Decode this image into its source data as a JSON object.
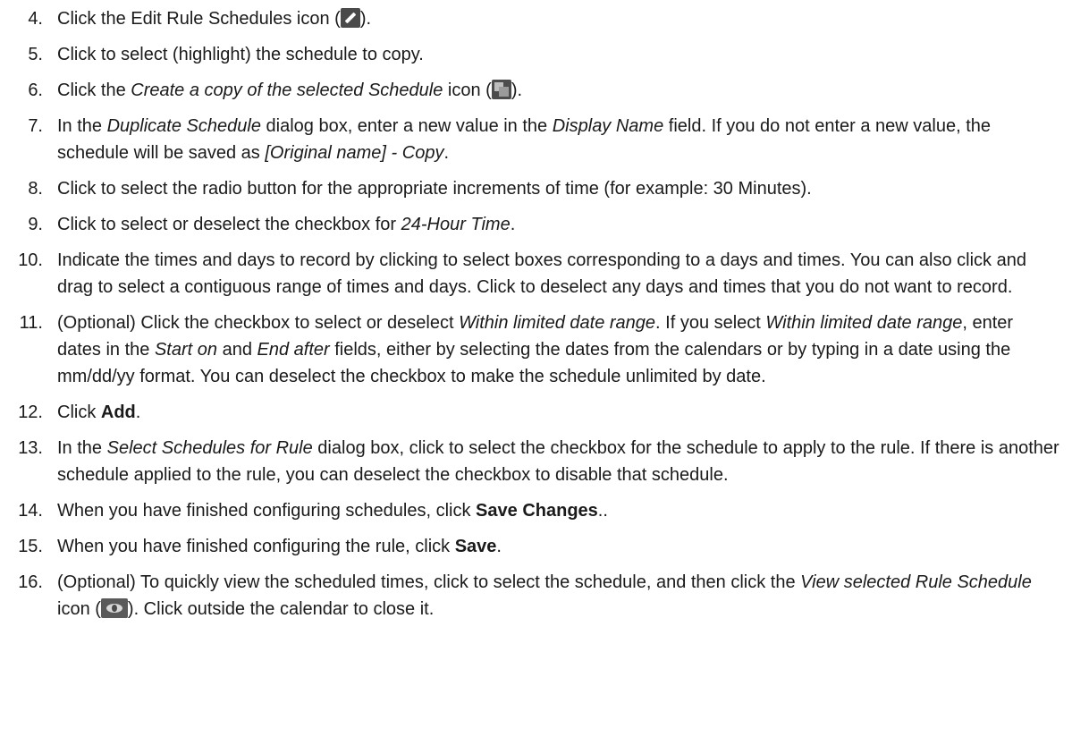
{
  "steps": [
    {
      "num": "4.",
      "parts": [
        "Click the Edit Rule Schedules icon (",
        ")."
      ]
    },
    {
      "num": "5.",
      "parts": [
        "Click to select (highlight) the schedule to copy."
      ]
    },
    {
      "num": "6.",
      "parts": [
        "Click the ",
        "Create a copy of the selected Schedule",
        " icon (",
        ")."
      ]
    },
    {
      "num": "7.",
      "parts": [
        "In the ",
        "Duplicate Schedule",
        " dialog box, enter a new value in the ",
        "Display Name",
        " field. If you do not enter a new value, the schedule will be saved as ",
        "[Original name] - Copy",
        "."
      ]
    },
    {
      "num": "8.",
      "parts": [
        "Click to select the radio button for the appropriate increments of time (for example: 30 Minutes)."
      ]
    },
    {
      "num": "9.",
      "parts": [
        "Click to select or deselect the checkbox for ",
        "24-Hour Time",
        "."
      ]
    },
    {
      "num": "10.",
      "parts": [
        "Indicate the times and days to record by clicking to select boxes corresponding to a days and times. You can also click and drag to select a contiguous range of times and days. Click to deselect any days and times that you do not want to record."
      ]
    },
    {
      "num": "11.",
      "parts": [
        "(Optional) Click the checkbox to select or deselect ",
        "Within limited date range",
        ". If you select ",
        "Within limited date range",
        ", enter dates in the ",
        "Start on",
        " and ",
        "End after",
        " fields, either by selecting the dates from the calendars or by typing in a date using the mm/dd/yy format. You can deselect the checkbox to make the schedule unlimited by date."
      ]
    },
    {
      "num": "12.",
      "parts": [
        "Click ",
        "Add",
        "."
      ]
    },
    {
      "num": "13.",
      "parts": [
        "In the ",
        "Select Schedules for Rule",
        " dialog box, click to select the checkbox for the schedule to apply to the rule. If there is another schedule applied to the rule, you can deselect the checkbox to disable that schedule."
      ]
    },
    {
      "num": "14.",
      "parts": [
        "When you have finished configuring schedules, click ",
        "Save Changes",
        ".."
      ]
    },
    {
      "num": "15.",
      "parts": [
        "When you have finished configuring the rule, click ",
        "Save",
        "."
      ]
    },
    {
      "num": "16.",
      "parts": [
        "(Optional) To quickly view the scheduled times, click to select the schedule, and then click the ",
        "View selected Rule Schedule",
        " icon (",
        "). Click outside the calendar to close it."
      ]
    }
  ],
  "icons": {
    "edit": "pencil-icon",
    "copy": "copy-icon",
    "view": "eye-icon"
  }
}
